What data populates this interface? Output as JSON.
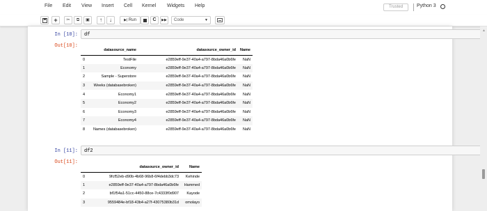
{
  "menubar": {
    "items": [
      "File",
      "Edit",
      "View",
      "Insert",
      "Cell",
      "Kernel",
      "Widgets",
      "Help"
    ],
    "trusted": "Trusted",
    "kernel": "Python 3"
  },
  "toolbar": {
    "run_label": "Run",
    "cell_type": "Code"
  },
  "cells": [
    {
      "in_prompt": "In [10]:",
      "code": "df",
      "out_prompt": "Out[10]:",
      "table": {
        "columns": [
          "",
          "datasource_name",
          "datasource_owner_id",
          "Name"
        ],
        "rows": [
          [
            "0",
            "TestFile",
            "e2859eff-9e37-40a4-a797-8bda46a0b6fe",
            "NaN"
          ],
          [
            "1",
            "Economy",
            "e2859eff-9e37-40a4-a797-8bda46a0b6fe",
            "NaN"
          ],
          [
            "2",
            "Sample - Superstore",
            "e2859eff-9e37-40a4-a797-8bda46a0b6fe",
            "NaN"
          ],
          [
            "3",
            "Weeks (databasebroken)",
            "e2859eff-9e37-40a4-a797-8bda46a0b6fe",
            "NaN"
          ],
          [
            "4",
            "Economy1",
            "e2859eff-9e37-40a4-a797-8bda46a0b6fe",
            "NaN"
          ],
          [
            "5",
            "Economy2",
            "e2859eff-9e37-40a4-a797-8bda46a0b6fe",
            "NaN"
          ],
          [
            "6",
            "Economy3",
            "e2859eff-9e37-40a4-a797-8bda46a0b6fe",
            "NaN"
          ],
          [
            "7",
            "Economy4",
            "e2859eff-9e37-40a4-a797-8bda46a0b6fe",
            "NaN"
          ],
          [
            "8",
            "Names (databasebroken)",
            "e2859eff-9e37-40a4-a797-8bda46a0b6fe",
            "NaN"
          ]
        ]
      }
    },
    {
      "in_prompt": "In [11]:",
      "code": "df2",
      "out_prompt": "Out[11]:",
      "table": {
        "columns": [
          "",
          "datasource_owner_id",
          "Name"
        ],
        "rows": [
          [
            "0",
            "9fcf52eb-d90b-4b68-96b8-6f4debb3dc73",
            "Kehinde"
          ],
          [
            "1",
            "e2859eff-9e37-40a4-a797-8bda46a0b6fe",
            "Hammed"
          ],
          [
            "2",
            "bf1f54a1-51cc-4450-88ce-7c4333f0d907",
            "Kayode"
          ],
          [
            "3",
            "9559484e-bf18-43b4-a27f-43075380b31d",
            "omolayo"
          ]
        ]
      }
    }
  ]
}
